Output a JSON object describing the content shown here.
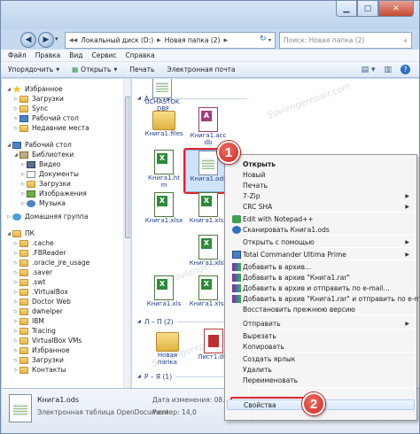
{
  "address": {
    "crumbs": [
      "Локальный диск (D:)",
      "Новая папка (2)"
    ],
    "search_placeholder": "Поиск: Новая папка (2)"
  },
  "menu": [
    "Файл",
    "Правка",
    "Вид",
    "Сервис",
    "Справка"
  ],
  "toolbar": {
    "organize": "Упорядочить",
    "open": "Открыть",
    "print": "Печать",
    "email": "Электронная почта"
  },
  "nav": [
    {
      "label": "Избранное",
      "icon": "star"
    },
    {
      "label": "Загрузки",
      "icon": "folder"
    },
    {
      "label": "Sync",
      "icon": "folder"
    },
    {
      "label": "Рабочий стол",
      "icon": "desk"
    },
    {
      "label": "Недавние места",
      "icon": "folder"
    },
    {
      "label": "Рабочий стол",
      "icon": "desk"
    },
    {
      "label": "Библиотеки",
      "icon": "lib"
    },
    {
      "label": "Видео",
      "icon": "video"
    },
    {
      "label": "Документы",
      "icon": "doc"
    },
    {
      "label": "Загрузки",
      "icon": "folder"
    },
    {
      "label": "Изображения",
      "icon": "img"
    },
    {
      "label": "Музыка",
      "icon": "music"
    },
    {
      "label": "Домашняя группа",
      "icon": "home"
    },
    {
      "label": "ПК",
      "icon": "folder"
    },
    {
      "label": ".cache",
      "icon": "folder"
    },
    {
      "label": ".FBReader",
      "icon": "folder"
    },
    {
      "label": ".oracle_jre_usage",
      "icon": "folder"
    },
    {
      "label": ".saver",
      "icon": "folder"
    },
    {
      "label": ".swt",
      "icon": "folder"
    },
    {
      "label": ".VirtualBox",
      "icon": "folder"
    },
    {
      "label": "Doctor Web",
      "icon": "folder"
    },
    {
      "label": "dwhelper",
      "icon": "folder"
    },
    {
      "label": "IBM",
      "icon": "folder"
    },
    {
      "label": "Tracing",
      "icon": "folder"
    },
    {
      "label": "VirtualBox VMs",
      "icon": "folder"
    },
    {
      "label": "Избранное",
      "icon": "folder"
    },
    {
      "label": "Загрузки",
      "icon": "folder"
    },
    {
      "label": "Контакты",
      "icon": "folder"
    }
  ],
  "groups": {
    "ak": "А – К (9)",
    "lp": "Л – П (2)",
    "ri": "Р – Я (1)"
  },
  "files": [
    {
      "name": "UCHASTOK",
      "name2": ".DBF",
      "type": "sheet"
    },
    {
      "name": "Книга1.files",
      "name2": "",
      "type": "folder"
    },
    {
      "name": "Книга1.acc",
      "name2": "db",
      "type": "acc"
    },
    {
      "name": "Книга1.ht",
      "name2": "m",
      "type": "xls"
    },
    {
      "name": "Книга1.ods",
      "name2": "",
      "type": "sheet"
    },
    {
      "name": "Книга1.xlsx",
      "name2": "",
      "type": "xls"
    },
    {
      "name": "Книга1.xlsx",
      "name2": "",
      "type": "xls"
    },
    {
      "name": "Книга1.xlsx",
      "name2": "",
      "type": "xls"
    },
    {
      "name": "Книга1.xls",
      "name2": "",
      "type": "xls"
    },
    {
      "name": "Книга1.xlsx",
      "name2": "",
      "type": "xls"
    },
    {
      "name": "Новая",
      "name2": "папка",
      "type": "folder"
    },
    {
      "name": "Лист1.dbf",
      "name2": "",
      "type": "pdf"
    }
  ],
  "details": {
    "name": "Книга1.ods",
    "type": "Электронная таблица OpenDocument",
    "modified_label": "Дата изменения: 08.0",
    "size_label": "Размер: 14,0"
  },
  "context_menu": [
    {
      "label": "Открыть",
      "bold": true,
      "icon": "",
      "arrow": false
    },
    {
      "label": "Новый",
      "bold": false,
      "icon": "",
      "arrow": false
    },
    {
      "label": "Печать",
      "bold": false,
      "icon": "",
      "arrow": false
    },
    {
      "label": "7-Zip",
      "bold": false,
      "icon": "",
      "arrow": true
    },
    {
      "label": "CRC SHA",
      "bold": false,
      "icon": "",
      "arrow": true
    },
    {
      "label": "Edit with Notepad++",
      "bold": false,
      "icon": "np",
      "arrow": false
    },
    {
      "label": "Сканировать Книга1.ods",
      "bold": false,
      "icon": "av",
      "arrow": false
    },
    {
      "label": "Открыть с помощью",
      "bold": false,
      "icon": "",
      "arrow": true
    },
    {
      "label": "Total Commander Ultima Prime",
      "bold": false,
      "icon": "tc",
      "arrow": true
    },
    {
      "label": "Добавить в архив...",
      "bold": false,
      "icon": "rar",
      "arrow": false
    },
    {
      "label": "Добавить в архив \"Книга1.rar\"",
      "bold": false,
      "icon": "rar",
      "arrow": false
    },
    {
      "label": "Добавить в архив и отправить по e-mail...",
      "bold": false,
      "icon": "rar",
      "arrow": false
    },
    {
      "label": "Добавить в архив \"Книга1.rar\" и отправить по e-mail",
      "bold": false,
      "icon": "rar",
      "arrow": false
    },
    {
      "label": "Восстановить прежнюю версию",
      "bold": false,
      "icon": "",
      "arrow": false
    },
    {
      "label": "Отправить",
      "bold": false,
      "icon": "",
      "arrow": true
    },
    {
      "label": "Вырезать",
      "bold": false,
      "icon": "",
      "arrow": false
    },
    {
      "label": "Копировать",
      "bold": false,
      "icon": "",
      "arrow": false
    },
    {
      "label": "Создать ярлык",
      "bold": false,
      "icon": "",
      "arrow": false
    },
    {
      "label": "Удалить",
      "bold": false,
      "icon": "",
      "arrow": false
    },
    {
      "label": "Переименовать",
      "bold": false,
      "icon": "",
      "arrow": false
    },
    {
      "label": "Свойства",
      "bold": false,
      "icon": "",
      "arrow": false
    }
  ],
  "badges": [
    "1",
    "2"
  ],
  "watermark": "Sovlengerepair.com",
  "colors": {
    "accent": "#1e3f8c",
    "highlight": "#e0242a",
    "badge": "#cc2c24"
  }
}
